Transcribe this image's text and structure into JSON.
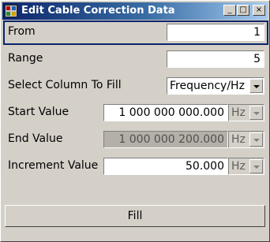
{
  "window": {
    "title": "Edit Cable Correction Data",
    "minimize_glyph": "_",
    "maximize_glyph": "□",
    "close_glyph": "×"
  },
  "form": {
    "from": {
      "label": "From",
      "value": "1"
    },
    "range": {
      "label": "Range",
      "value": "5"
    },
    "select_column": {
      "label": "Select Column To Fill",
      "value": "Frequency/Hz"
    },
    "start_value": {
      "label": "Start Value",
      "value": "1 000 000 000.000",
      "unit": "Hz"
    },
    "end_value": {
      "label": "End Value",
      "value": "1 000 000 200.000",
      "unit": "Hz"
    },
    "increment_value": {
      "label": "Increment Value",
      "value": "50.000",
      "unit": "Hz"
    },
    "fill_button": "Fill"
  }
}
